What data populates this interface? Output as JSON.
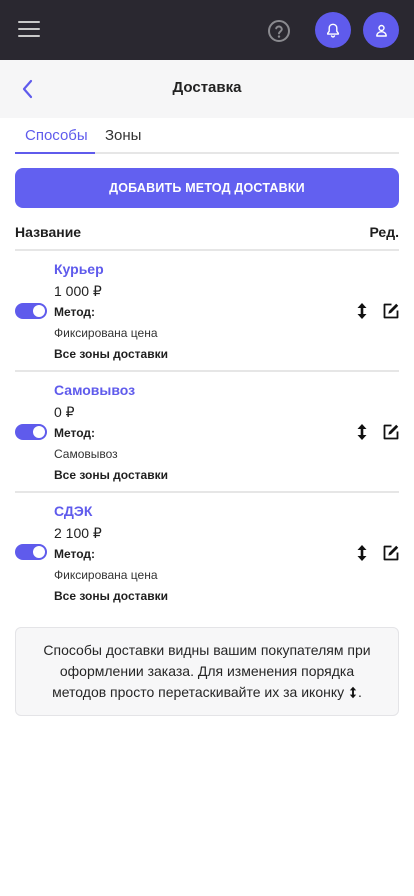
{
  "page": {
    "title": "Доставка"
  },
  "tabs": [
    {
      "label": "Способы",
      "active": true
    },
    {
      "label": "Зоны",
      "active": false
    }
  ],
  "actions": {
    "add_method_label": "ДОБАВИТЬ МЕТОД ДОСТАВКИ"
  },
  "table": {
    "headers": {
      "name": "Название",
      "edit": "Ред."
    },
    "rows": [
      {
        "name": "Курьер",
        "price": "1 000 ₽",
        "method_label": "Метод:",
        "method_value": "Фиксирована цена",
        "zones": "Все зоны доставки",
        "enabled": true
      },
      {
        "name": "Самовывоз",
        "price": "0 ₽",
        "method_label": "Метод:",
        "method_value": "Самовывоз",
        "zones": "Все зоны доставки",
        "enabled": true
      },
      {
        "name": "СДЭК",
        "price": "2 100 ₽",
        "method_label": "Метод:",
        "method_value": "Фиксирована цена",
        "zones": "Все зоны доставки",
        "enabled": true
      }
    ]
  },
  "info": {
    "text_before_icon": "Способы доставки видны вашим покупателям при оформлении заказа. Для изменения порядка методов просто перетаскивайте их за иконку",
    "text_after_icon": "."
  },
  "colors": {
    "accent": "#5f5bec",
    "topbar": "#2a2830",
    "header_bg": "#f6f6f7"
  },
  "icons": {
    "menu": "hamburger-menu-icon",
    "help": "question-circle-icon",
    "notifications": "bell-icon",
    "profile": "user-icon",
    "back": "chevron-left-icon",
    "drag": "vertical-arrows-icon",
    "edit": "edit-pencil-icon"
  }
}
